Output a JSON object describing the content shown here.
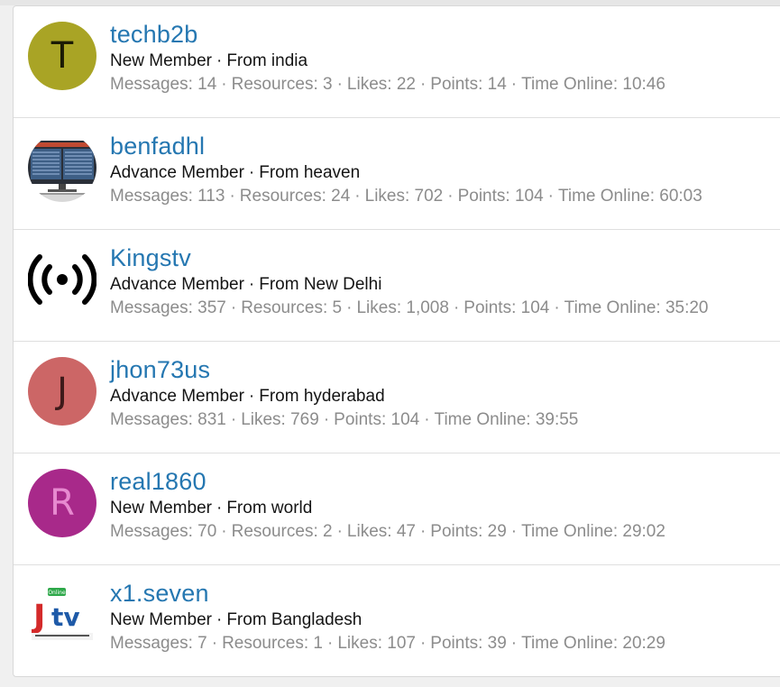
{
  "colors": {
    "username": "#2577b1",
    "stat_text": "#8c8c8c",
    "title_text": "#141414"
  },
  "members": [
    {
      "username": "techb2b",
      "title": "New Member",
      "location_text": "From india",
      "avatar_letter": "T",
      "avatar_bg": "#a9a425",
      "avatar_fg": "#1b1b05",
      "stats": {
        "messages": "Messages: 14",
        "resources": "Resources: 3",
        "likes": "Likes: 22",
        "points": "Points: 14",
        "time_online": "Time Online: 10:46"
      }
    },
    {
      "username": "benfadhl",
      "title": "Advance Member",
      "location_text": "From heaven",
      "avatar_icon": "satellite-receiver-icon",
      "stats": {
        "messages": "Messages: 113",
        "resources": "Resources: 24",
        "likes": "Likes: 702",
        "points": "Points: 104",
        "time_online": "Time Online: 60:03"
      }
    },
    {
      "username": "Kingstv",
      "title": "Advance Member",
      "location_text": "From New Delhi",
      "avatar_icon": "broadcast-signal-icon",
      "stats": {
        "messages": "Messages: 357",
        "resources": "Resources: 5",
        "likes": "Likes: 1,008",
        "points": "Points: 104",
        "time_online": "Time Online: 35:20"
      }
    },
    {
      "username": "jhon73us",
      "title": "Advance Member",
      "location_text": "From hyderabad",
      "avatar_letter": "J",
      "avatar_bg": "#cc6666",
      "avatar_fg": "#3d1a1a",
      "stats": {
        "messages": "Messages: 831",
        "likes": "Likes: 769",
        "points": "Points: 104",
        "time_online": "Time Online: 39:55"
      }
    },
    {
      "username": "real1860",
      "title": "New Member",
      "location_text": "From world",
      "avatar_letter": "R",
      "avatar_bg": "#a8298a",
      "avatar_fg": "#e78ad0",
      "stats": {
        "messages": "Messages: 70",
        "resources": "Resources: 2",
        "likes": "Likes: 47",
        "points": "Points: 29",
        "time_online": "Time Online: 29:02"
      }
    },
    {
      "username": "x1.seven",
      "title": "New Member",
      "location_text": "From Bangladesh",
      "avatar_icon": "jtv-logo-icon",
      "avatar_logo_text": "Jtv",
      "avatar_logo_badge": "Online",
      "stats": {
        "messages": "Messages: 7",
        "resources": "Resources: 1",
        "likes": "Likes: 107",
        "points": "Points: 39",
        "time_online": "Time Online: 20:29"
      }
    }
  ]
}
